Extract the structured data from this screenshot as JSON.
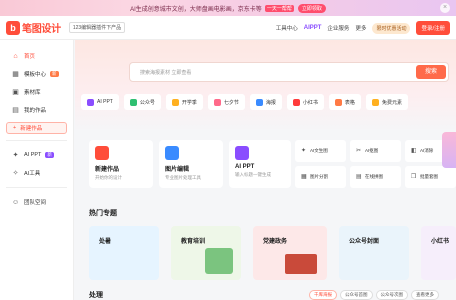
{
  "banner": {
    "text": "AI生成创意城市文创，大师盘画电影画，京东卡等",
    "tag": "一天一帮帮",
    "badge": "立即领取"
  },
  "header": {
    "logo_text": "笔图设计",
    "extension": "123编辑器插件下产品",
    "nav": [
      "工具中心",
      "AIPPT",
      "企业服务",
      "更多"
    ],
    "vip": "限时优惠活动",
    "login": "登录/注册"
  },
  "sidebar": {
    "items": [
      {
        "label": "首页",
        "icon": "home-icon"
      },
      {
        "label": "模板中心",
        "badge": "新"
      },
      {
        "label": "素材库"
      },
      {
        "label": "我的作品"
      }
    ],
    "create": "新建作品",
    "ai_items": [
      {
        "label": "AI PPT",
        "badge": "新"
      },
      {
        "label": "AI工具"
      }
    ],
    "team": "团队空间"
  },
  "search": {
    "placeholder": "搜索海报素材 立即查看",
    "button": "搜索"
  },
  "categories": [
    {
      "label": "AI PPT",
      "color": "#8a4dff"
    },
    {
      "label": "公众号",
      "color": "#2fbf71"
    },
    {
      "label": "开学季",
      "color": "#ffb020"
    },
    {
      "label": "七夕节",
      "color": "#ff6a8a"
    },
    {
      "label": "海报",
      "color": "#3a8bff"
    },
    {
      "label": "小红书",
      "color": "#ff3b3b"
    },
    {
      "label": "表格",
      "color": "#ff7a45"
    },
    {
      "label": "免费元素",
      "color": "#ffb020"
    }
  ],
  "features": [
    {
      "title": "新建作品",
      "subtitle": "开始你的设计",
      "color": "#ff4d3a"
    },
    {
      "title": "图片编辑",
      "subtitle": "专业图片处理工具",
      "color": "#3a8bff"
    },
    {
      "title": "AI PPT",
      "subtitle": "输入标题一键生成",
      "color": "#8a4dff"
    }
  ],
  "tools": [
    "AI文生图",
    "AI抠图",
    "AI消除",
    "图片分割",
    "在线拼图",
    "批量套图"
  ],
  "sections": {
    "hot": "热门专题",
    "more": "处理"
  },
  "templates": [
    {
      "label": "处暑",
      "bg": "#e6f4ff"
    },
    {
      "label": "教育培训",
      "bg": "#eef7e8"
    },
    {
      "label": "党建政务",
      "bg": "#fde8e8"
    },
    {
      "label": "公众号封面",
      "bg": "#eaf4fb"
    },
    {
      "label": "小红书",
      "bg": "#f6eefb"
    }
  ],
  "chips": [
    "千库海报",
    "公众号首图",
    "公众号次图",
    "查看更多"
  ]
}
